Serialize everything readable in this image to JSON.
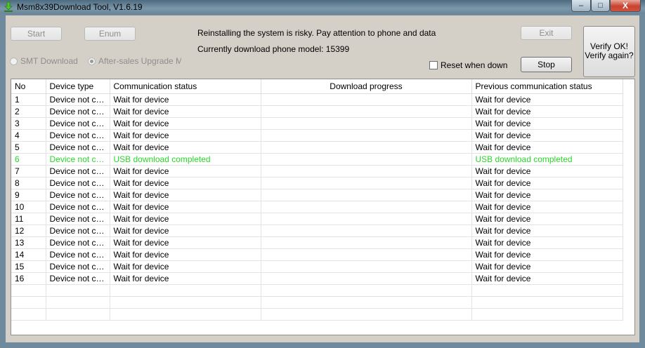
{
  "window": {
    "title": "Msm8x39Download Tool, V1.6.19",
    "minimize_glyph": "–",
    "maximize_glyph": "□",
    "close_glyph": "X"
  },
  "toolbar": {
    "start_label": "Start",
    "enum_label": "Enum",
    "exit_label": "Exit",
    "stop_label": "Stop",
    "verify_line1": "Verify OK!",
    "verify_line2": "Verify again?"
  },
  "info": {
    "warning": "Reinstalling the system is risky. Pay attention to phone and data",
    "model_line": "Currently download phone model: 15399"
  },
  "modes": {
    "smt": "SMT Download Mo",
    "aftersales": "After-sales Upgrade Mod",
    "selected": "aftersales"
  },
  "reset_checkbox": {
    "label": "Reset when downlo",
    "checked": false
  },
  "colors": {
    "success": "#27d827"
  },
  "table": {
    "headers": [
      "No",
      "Device type",
      "Communication status",
      "Download progress",
      "Previous communication status"
    ],
    "rows": [
      {
        "no": "1",
        "type": "Device not co...",
        "status": "Wait for device",
        "progress": "",
        "prev": "Wait for device"
      },
      {
        "no": "2",
        "type": "Device not co...",
        "status": "Wait for device",
        "progress": "",
        "prev": "Wait for device"
      },
      {
        "no": "3",
        "type": "Device not co...",
        "status": "Wait for device",
        "progress": "",
        "prev": "Wait for device"
      },
      {
        "no": "4",
        "type": "Device not co...",
        "status": "Wait for device",
        "progress": "",
        "prev": "Wait for device"
      },
      {
        "no": "5",
        "type": "Device not co...",
        "status": "Wait for device",
        "progress": "",
        "prev": "Wait for device"
      },
      {
        "no": "6",
        "type": "Device not co...",
        "status": "USB download completed",
        "progress": "",
        "prev": "USB download completed",
        "ok": true
      },
      {
        "no": "7",
        "type": "Device not co...",
        "status": "Wait for device",
        "progress": "",
        "prev": "Wait for device"
      },
      {
        "no": "8",
        "type": "Device not co...",
        "status": "Wait for device",
        "progress": "",
        "prev": "Wait for device"
      },
      {
        "no": "9",
        "type": "Device not co...",
        "status": "Wait for device",
        "progress": "",
        "prev": "Wait for device"
      },
      {
        "no": "10",
        "type": "Device not co...",
        "status": "Wait for device",
        "progress": "",
        "prev": "Wait for device"
      },
      {
        "no": "11",
        "type": "Device not co...",
        "status": "Wait for device",
        "progress": "",
        "prev": "Wait for device"
      },
      {
        "no": "12",
        "type": "Device not co...",
        "status": "Wait for device",
        "progress": "",
        "prev": "Wait for device"
      },
      {
        "no": "13",
        "type": "Device not co...",
        "status": "Wait for device",
        "progress": "",
        "prev": "Wait for device"
      },
      {
        "no": "14",
        "type": "Device not co...",
        "status": "Wait for device",
        "progress": "",
        "prev": "Wait for device"
      },
      {
        "no": "15",
        "type": "Device not co...",
        "status": "Wait for device",
        "progress": "",
        "prev": "Wait for device"
      },
      {
        "no": "16",
        "type": "Device not co...",
        "status": "Wait for device",
        "progress": "",
        "prev": "Wait for device"
      }
    ]
  }
}
